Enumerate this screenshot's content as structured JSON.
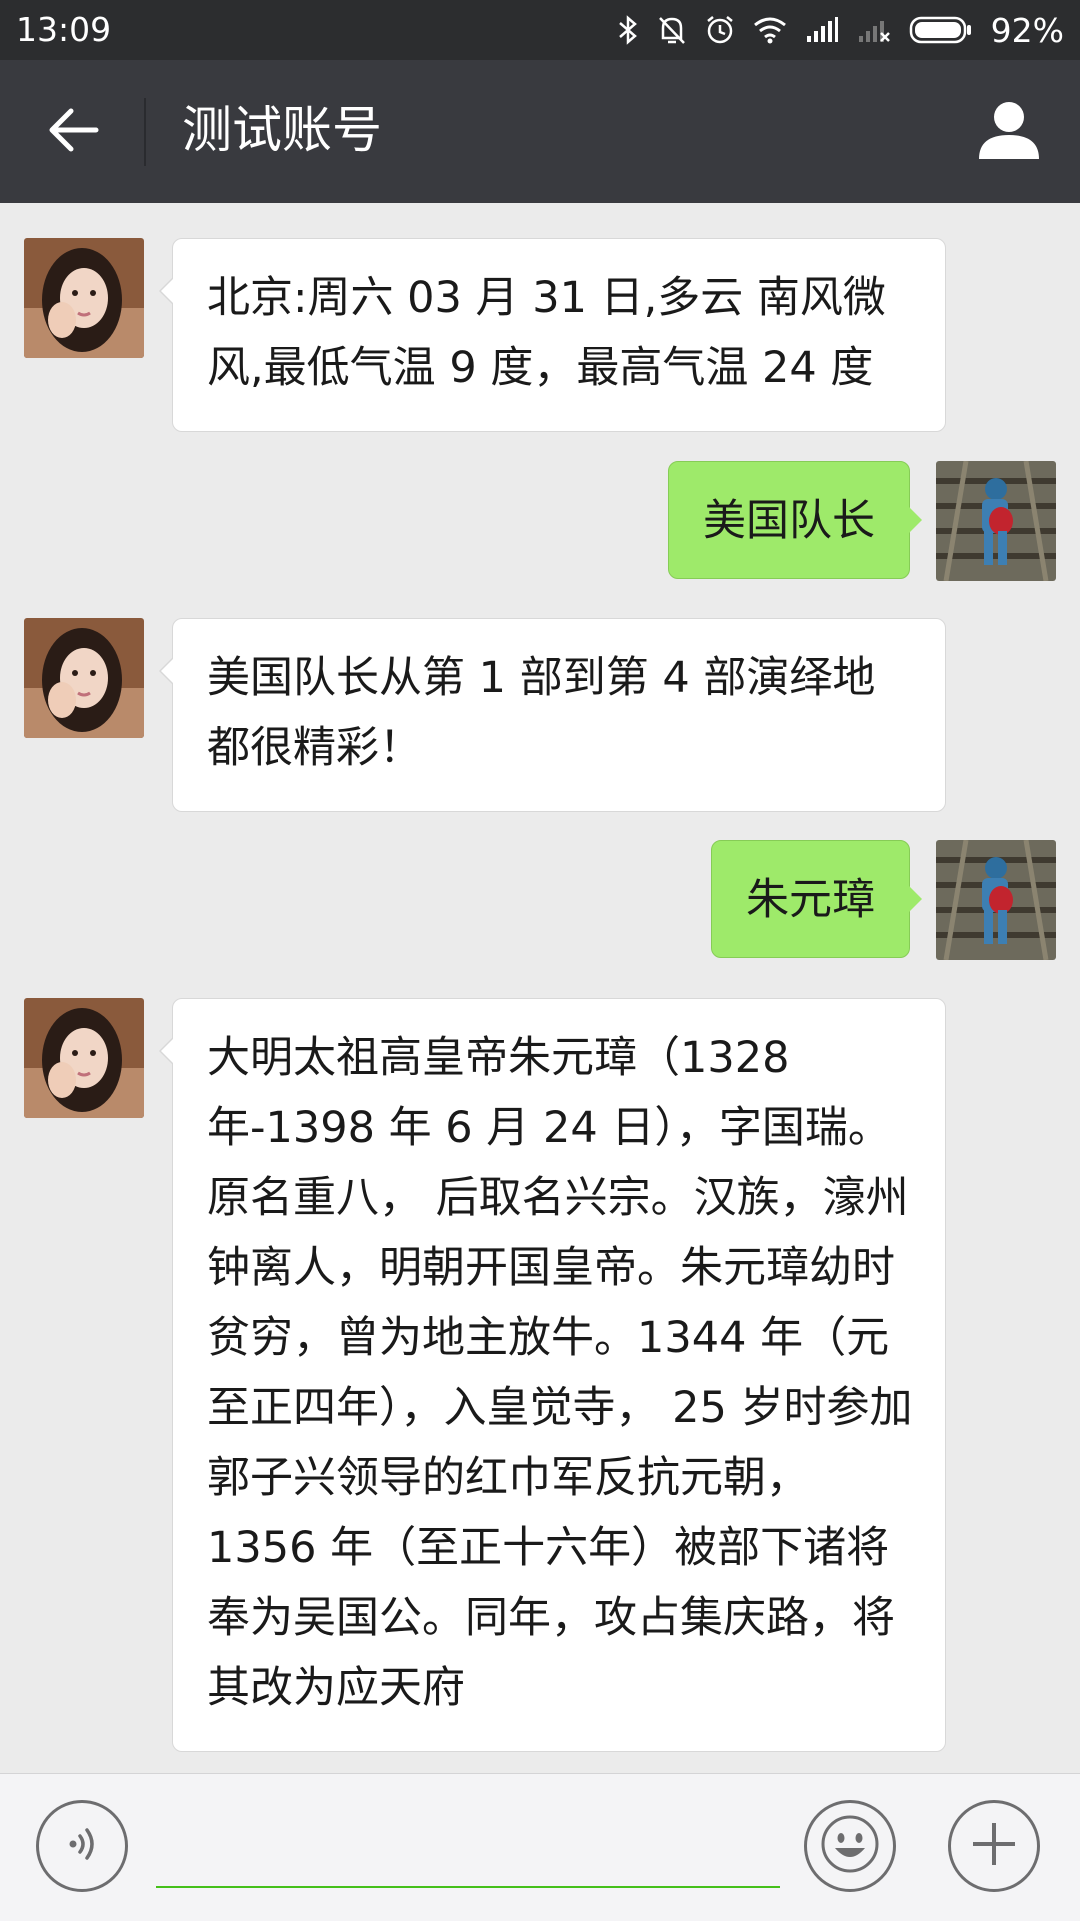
{
  "status_bar": {
    "time": "13:09",
    "battery_percent": "92%",
    "icons": [
      "bluetooth-icon",
      "mute-icon",
      "alarm-icon",
      "wifi-icon",
      "signal-icon",
      "no-signal-icon",
      "battery-icon"
    ]
  },
  "header": {
    "title": "测试账号",
    "back_icon": "arrow-left-icon",
    "profile_icon": "person-icon"
  },
  "messages": [
    {
      "direction": "in",
      "text": "北京:周六 03 月 31 日,多云 南风微风,最低气温 9 度，最高气温 24 度"
    },
    {
      "direction": "out",
      "text": "美国队长"
    },
    {
      "direction": "in",
      "text": "美国队长从第 1 部到第 4 部演绎地都很精彩！"
    },
    {
      "direction": "out",
      "text": "朱元璋"
    },
    {
      "direction": "in",
      "text": "大明太祖高皇帝朱元璋（1328 年-1398 年 6 月 24 日），字国瑞。 原名重八， 后取名兴宗。汉族，濠州钟离人，明朝开国皇帝。朱元璋幼时贫穷，曾为地主放牛。1344 年（元至正四年），入皇觉寺， 25 岁时参加郭子兴领导的红巾军反抗元朝， 1356 年（至正十六年）被部下诸将奉为吴国公。同年，攻占集庆路，将其改为应天府"
    }
  ],
  "input_bar": {
    "text_value": "",
    "voice_icon": "voice-icon",
    "emoji_icon": "emoji-icon",
    "plus_icon": "plus-icon"
  },
  "colors": {
    "status_bar_bg": "#2c2d2f",
    "title_bar_bg": "#393a3f",
    "chat_bg": "#ebebeb",
    "outgoing_bubble": "#9eea6a",
    "incoming_bubble": "#ffffff",
    "input_underline": "#45c01a"
  }
}
